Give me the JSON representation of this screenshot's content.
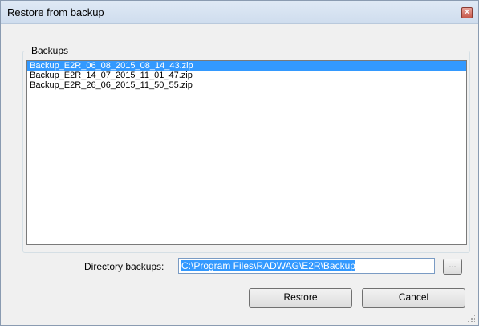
{
  "window": {
    "title": "Restore from backup"
  },
  "backups": {
    "group_label": "Backups",
    "items": [
      "Backup_E2R_06_08_2015_08_14_43.zip",
      "Backup_E2R_14_07_2015_11_01_47.zip",
      "Backup_E2R_26_06_2015_11_50_55.zip"
    ],
    "selected_index": 0
  },
  "directory": {
    "label": "Directory backups:",
    "value": "C:\\Program Files\\RADWAG\\E2R\\Backup",
    "browse_label": "..."
  },
  "buttons": {
    "restore": "Restore",
    "cancel": "Cancel"
  },
  "colors": {
    "selection": "#3399ff",
    "close": "#c7584a"
  },
  "icons": {
    "close": "close-icon",
    "resize": "resize-grip-icon"
  }
}
